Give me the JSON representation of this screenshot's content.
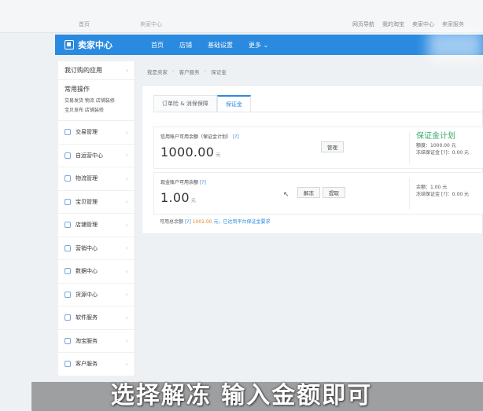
{
  "topbar": {
    "home_label": "首页",
    "address": "卖家中心",
    "links": [
      "网页导航",
      "我的淘宝",
      "卖家中心",
      "卖家服务"
    ]
  },
  "navbar": {
    "brand": "卖家中心",
    "items": [
      "首页",
      "店铺",
      "基础设置",
      "更多"
    ]
  },
  "sidebar": {
    "header": "我订购的应用",
    "common_title": "常用操作",
    "common_lines": [
      "交易发货 物流 店铺装修",
      "宝贝发布 店铺装修"
    ],
    "items": [
      "交易管理",
      "自运营中心",
      "物流管理",
      "宝贝管理",
      "店铺管理",
      "营销中心",
      "数据中心",
      "货源中心",
      "软件服务",
      "淘宝服务",
      "客户服务"
    ]
  },
  "breadcrumb": [
    "我是卖家",
    "客户服务",
    "保证金"
  ],
  "tabs": [
    "订单险 & 消保保障",
    "保证金"
  ],
  "active_tab": 1,
  "card1": {
    "label": "信用账户可用余额（保证金计划）",
    "help": "[?]",
    "amount": "1000.00",
    "unit": "元",
    "button": "管理",
    "stats_title": "保证金计划",
    "stats": [
      "额度：1000.00 元",
      "冻结保证金 [?]：0.00 元"
    ]
  },
  "card2": {
    "label": "现金账户可用余额",
    "help": "[?]",
    "amount": "1.00",
    "unit": "元",
    "buttons": [
      "解冻",
      "提取"
    ],
    "stats": [
      "余额：1.00 元",
      "冻结保证金 [?]：0.00 元"
    ]
  },
  "note": {
    "prefix": "可用总余额",
    "help": "[?]",
    "value": "1001.00",
    "suffix": "元，已达到平台保证金要求"
  },
  "subtitle": "选择解冻 输入金额即可",
  "colors": {
    "nav_blue": "#2a8ae0",
    "accent_green": "#39a86c",
    "highlight_orange": "#e0821f"
  }
}
